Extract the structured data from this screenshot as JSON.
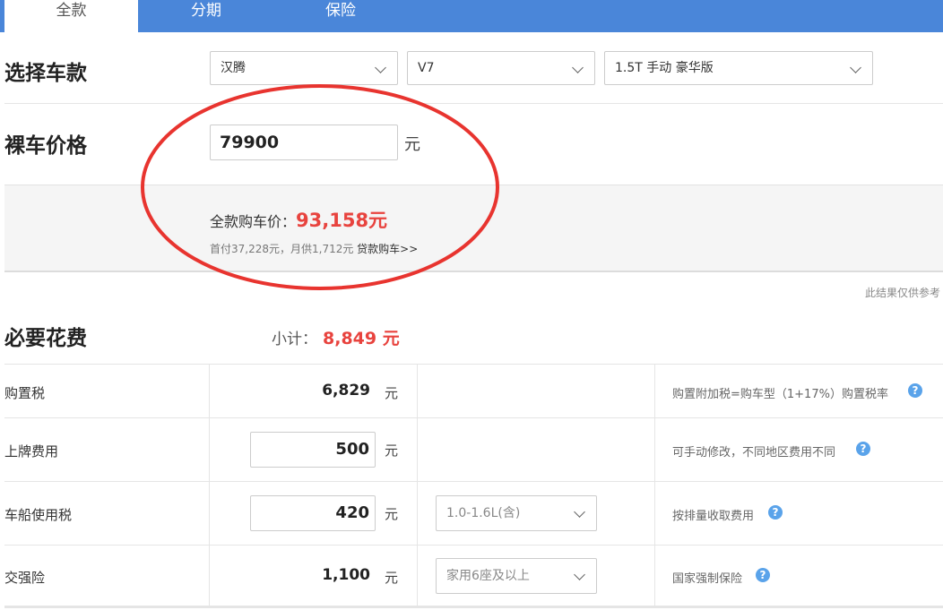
{
  "tabs": [
    {
      "label": "全款",
      "active": true
    },
    {
      "label": "分期",
      "active": false
    },
    {
      "label": "保险",
      "active": false
    }
  ],
  "select_model": {
    "title": "选择车款",
    "brand": "汉腾",
    "series": "V7",
    "trim": "1.5T 手动 豪华版"
  },
  "bare_price": {
    "title": "裸车价格",
    "value": "79900",
    "unit": "元"
  },
  "summary": {
    "total_label": "全款购车价：",
    "total_value": "93,158元",
    "sub_text": "首付37,228元，月供1,712元",
    "loan_link": "贷款购车>>"
  },
  "disclaimer": "此结果仅供参考",
  "required": {
    "title": "必要花费",
    "subtotal_label": "小计：",
    "subtotal_value": "8,849 元"
  },
  "rows": [
    {
      "label": "购置税",
      "value": "6,829",
      "unit": "元",
      "note": "购置附加税=购车型（1+17%）购置税率"
    },
    {
      "label": "上牌费用",
      "value": "500",
      "unit": "元",
      "note": "可手动修改，不同地区费用不同"
    },
    {
      "label": "车船使用税",
      "value": "420",
      "unit": "元",
      "select": "1.0-1.6L(含)",
      "note": "按排量收取费用"
    },
    {
      "label": "交强险",
      "value": "1,100",
      "unit": "元",
      "select": "家用6座及以上",
      "note": "国家强制保险"
    }
  ],
  "colors": {
    "tab_bar": "#4a86d9",
    "accent_red": "#e8433e",
    "help_icon": "#5aa3ea",
    "annotation_ellipse": "#e8342f"
  }
}
